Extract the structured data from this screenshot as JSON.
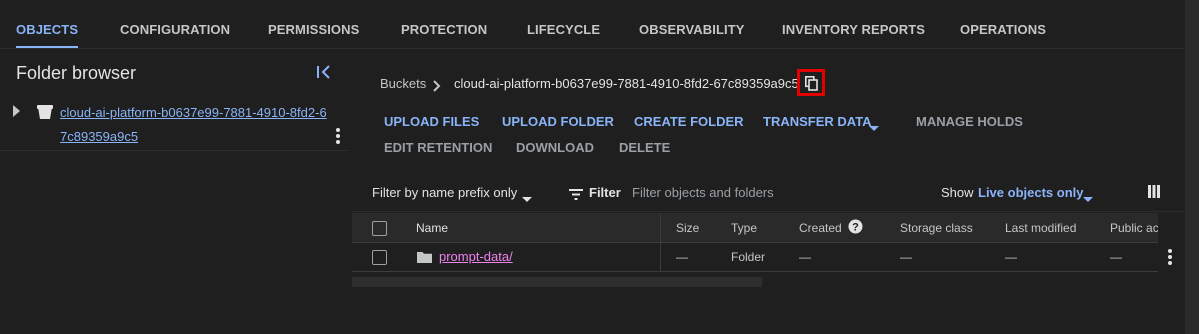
{
  "tabs": [
    {
      "label": "OBJECTS",
      "active": true
    },
    {
      "label": "CONFIGURATION"
    },
    {
      "label": "PERMISSIONS"
    },
    {
      "label": "PROTECTION"
    },
    {
      "label": "LIFECYCLE"
    },
    {
      "label": "OBSERVABILITY"
    },
    {
      "label": "INVENTORY REPORTS"
    },
    {
      "label": "OPERATIONS"
    }
  ],
  "sidebar": {
    "title": "Folder browser",
    "bucket_name": "cloud-ai-platform-b0637e99-7881-4910-8fd2-67c89359a9c5"
  },
  "breadcrumb": {
    "root": "Buckets",
    "current": "cloud-ai-platform-b0637e99-7881-4910-8fd2-67c89359a9c5"
  },
  "actions": {
    "upload_files": "UPLOAD FILES",
    "upload_folder": "UPLOAD FOLDER",
    "create_folder": "CREATE FOLDER",
    "transfer_data": "TRANSFER DATA",
    "manage_holds": "MANAGE HOLDS",
    "edit_retention": "EDIT RETENTION",
    "download": "DOWNLOAD",
    "delete": "DELETE"
  },
  "filter": {
    "mode": "Filter by name prefix only",
    "label": "Filter",
    "placeholder": "Filter objects and folders",
    "show_label": "Show",
    "show_value": "Live objects only"
  },
  "table": {
    "columns": {
      "name": "Name",
      "size": "Size",
      "type": "Type",
      "created": "Created",
      "storage_class": "Storage class",
      "last_modified": "Last modified",
      "public_access": "Public ac"
    },
    "rows": [
      {
        "name": "prompt-data/",
        "size": "—",
        "type": "Folder",
        "created": "—",
        "storage_class": "—",
        "last_modified": "—",
        "public_access": "—"
      }
    ]
  },
  "colors": {
    "accent": "#8ab4f8",
    "background": "#1f1f1f",
    "folder_link": "#ee82ee",
    "highlight": "#e50000"
  }
}
